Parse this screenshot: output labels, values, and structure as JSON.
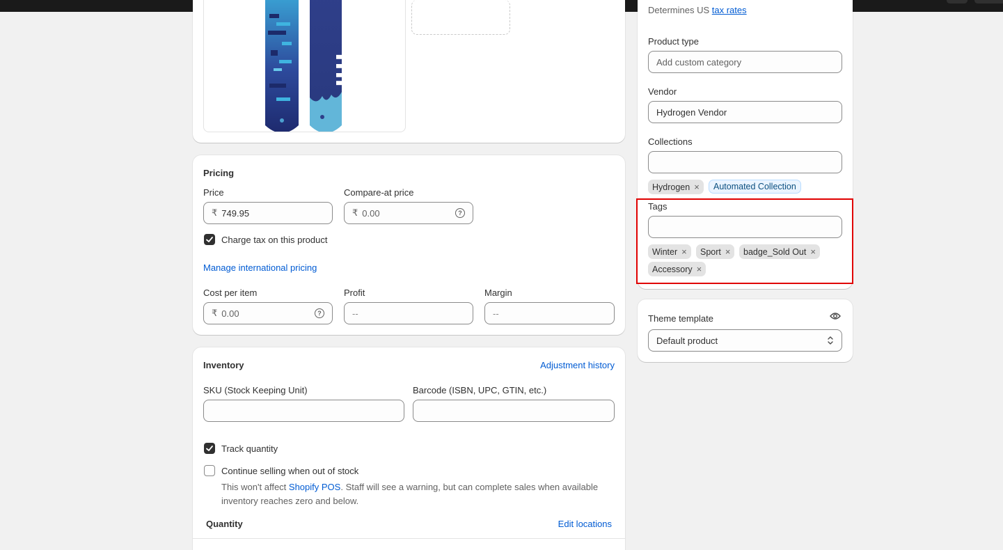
{
  "media": {
    "snowboard_text": "Hydrogen"
  },
  "pricing": {
    "title": "Pricing",
    "price_label": "Price",
    "price_prefix": "₹",
    "price_value": "749.95",
    "compare_label": "Compare-at price",
    "compare_prefix": "₹",
    "compare_placeholder": "0.00",
    "charge_tax_label": "Charge tax on this product",
    "manage_intl_link": "Manage international pricing",
    "cost_label": "Cost per item",
    "cost_prefix": "₹",
    "cost_placeholder": "0.00",
    "profit_label": "Profit",
    "profit_value": "--",
    "margin_label": "Margin",
    "margin_value": "--"
  },
  "inventory": {
    "title": "Inventory",
    "adjustment_link": "Adjustment history",
    "sku_label": "SKU (Stock Keeping Unit)",
    "barcode_label": "Barcode (ISBN, UPC, GTIN, etc.)",
    "track_label": "Track quantity",
    "continue_label": "Continue selling when out of stock",
    "helper_pre": "This won't affect ",
    "helper_link": "Shopify POS",
    "helper_post": ". Staff will see a warning, but can complete sales when available inventory reaches zero and below.",
    "quantity_title": "Quantity",
    "edit_locations_link": "Edit locations"
  },
  "organization": {
    "tax_note_text": "Determines US",
    "tax_note_link": "tax rates",
    "product_type_label": "Product type",
    "product_type_placeholder": "Add custom category",
    "vendor_label": "Vendor",
    "vendor_value": "Hydrogen Vendor",
    "collections_label": "Collections",
    "collections": [
      {
        "label": "Hydrogen",
        "style": "grey"
      },
      {
        "label": "Automated Collection",
        "style": "blue"
      }
    ],
    "tags_label": "Tags",
    "tags": [
      "Winter",
      "Sport",
      "badge_Sold Out",
      "Accessory"
    ],
    "highlight_color": "#e00000"
  },
  "theme": {
    "label": "Theme template",
    "value": "Default product"
  },
  "icons": {
    "remove": "×",
    "help": "question-circle-icon",
    "visibility": "eye-icon",
    "select": "chevron-up-down-icon",
    "check": "checkmark-icon"
  }
}
